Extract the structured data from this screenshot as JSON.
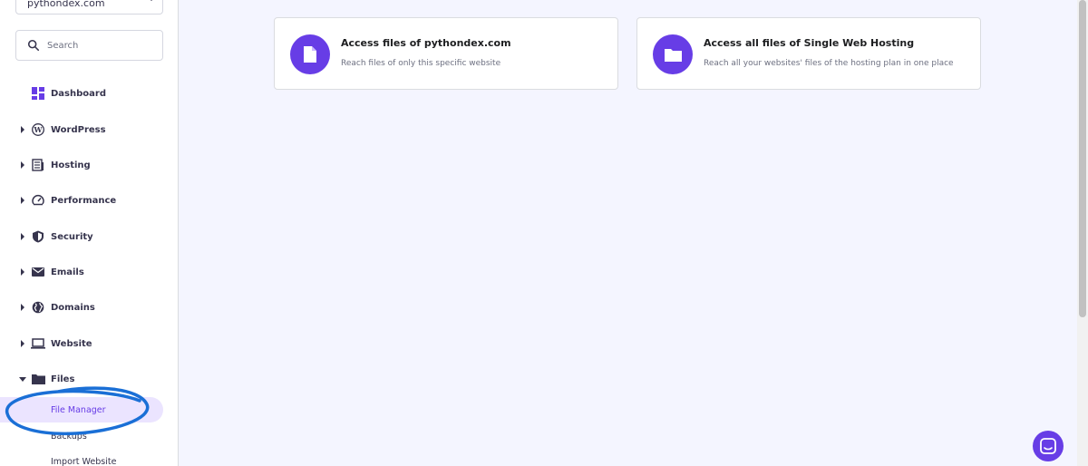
{
  "sidebar": {
    "site_selector": "pythondex.com",
    "search": {
      "placeholder": "Search",
      "value": ""
    },
    "items": [
      {
        "label": "Dashboard",
        "icon": "dashboard-icon",
        "expandable": false
      },
      {
        "label": "WordPress",
        "icon": "wordpress-icon",
        "expandable": true
      },
      {
        "label": "Hosting",
        "icon": "hosting-icon",
        "expandable": true
      },
      {
        "label": "Performance",
        "icon": "speedometer-icon",
        "expandable": true
      },
      {
        "label": "Security",
        "icon": "shield-icon",
        "expandable": true
      },
      {
        "label": "Emails",
        "icon": "envelope-icon",
        "expandable": true
      },
      {
        "label": "Domains",
        "icon": "globe-icon",
        "expandable": true
      },
      {
        "label": "Website",
        "icon": "laptop-icon",
        "expandable": true
      },
      {
        "label": "Files",
        "icon": "folder-icon",
        "expandable": true,
        "expanded": true
      }
    ],
    "files_subitems": [
      {
        "label": "File Manager",
        "active": true
      },
      {
        "label": "Backups",
        "active": false
      },
      {
        "label": "Import Website",
        "active": false
      }
    ]
  },
  "main": {
    "cards": [
      {
        "title": "Access files of pythondex.com",
        "description": "Reach files of only this specific website",
        "icon": "file-icon"
      },
      {
        "title": "Access all files of Single Web Hosting",
        "description": "Reach all your websites' files of the hosting plan in one place",
        "icon": "folder-icon"
      }
    ]
  },
  "colors": {
    "accent": "#673de6",
    "background": "#f4f5ff",
    "active_bg": "#ebe4ff",
    "annotation": "#1a6fd6"
  }
}
